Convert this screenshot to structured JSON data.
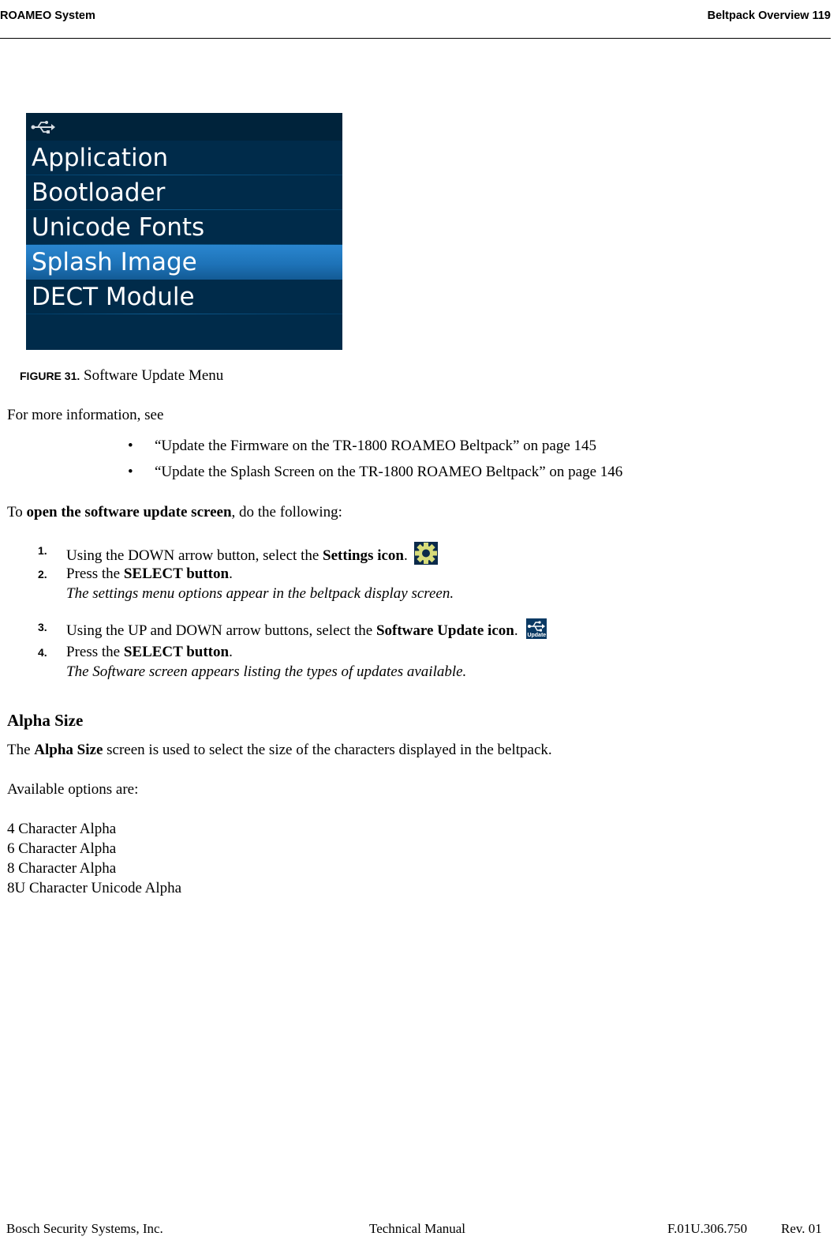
{
  "header": {
    "left": "ROAMEO System",
    "right": "Beltpack Overview  119"
  },
  "figure": {
    "screen": {
      "top_icon": "usb-icon",
      "items": [
        {
          "label": "Application",
          "selected": false
        },
        {
          "label": "Bootloader",
          "selected": false
        },
        {
          "label": "Unicode Fonts",
          "selected": false
        },
        {
          "label": "Splash Image",
          "selected": true
        },
        {
          "label": "DECT Module",
          "selected": false
        }
      ],
      "colors": {
        "background": "#002b4a",
        "topbar": "#00233b",
        "selected": "#1e73b8",
        "text": "#ffffff"
      }
    },
    "caption_label": "FIGURE 31.",
    "caption_text": "Software Update Menu"
  },
  "body": {
    "more_info": "For more information, see",
    "bullets": [
      "“Update the Firmware on the TR-1800 ROAMEO Beltpack” on page 145",
      "“Update the Splash Screen on the TR-1800 ROAMEO Beltpack” on page 146"
    ],
    "intro_prefix": "To ",
    "intro_bold": "open the software update screen",
    "intro_suffix": ", do the following:",
    "steps": [
      {
        "num": "1.",
        "pre": "Using the DOWN arrow button, select the ",
        "bold": "Settings icon",
        "post": ".",
        "icon": "settings-icon",
        "sub": ""
      },
      {
        "num": "2.",
        "pre": "Press the ",
        "bold": "SELECT button",
        "post": ".",
        "icon": "",
        "sub": "The settings menu options appear in the beltpack display screen."
      },
      {
        "num": "3.",
        "pre": "Using the UP and DOWN arrow buttons, select the ",
        "bold": "Software Update icon",
        "post": ".",
        "icon": "software-update-icon",
        "icon_label": "Update",
        "sub": ""
      },
      {
        "num": "4.",
        "pre": "Press the ",
        "bold": "SELECT button",
        "post": ".",
        "icon": "",
        "sub": "The Software screen appears listing the types of updates available."
      }
    ]
  },
  "alpha": {
    "heading": "Alpha Size",
    "desc_prefix": "The ",
    "desc_bold": "Alpha Size",
    "desc_suffix": " screen is used to select the size of the characters displayed in the beltpack.",
    "options_intro": "Available options are:",
    "options": [
      "4 Character Alpha",
      "6 Character Alpha",
      "8 Character Alpha",
      "8U Character Unicode Alpha"
    ]
  },
  "footer": {
    "company": "Bosch Security Systems, Inc.",
    "doc_type": "Technical Manual",
    "doc_number": "F.01U.306.750",
    "revision": "Rev. 01"
  }
}
